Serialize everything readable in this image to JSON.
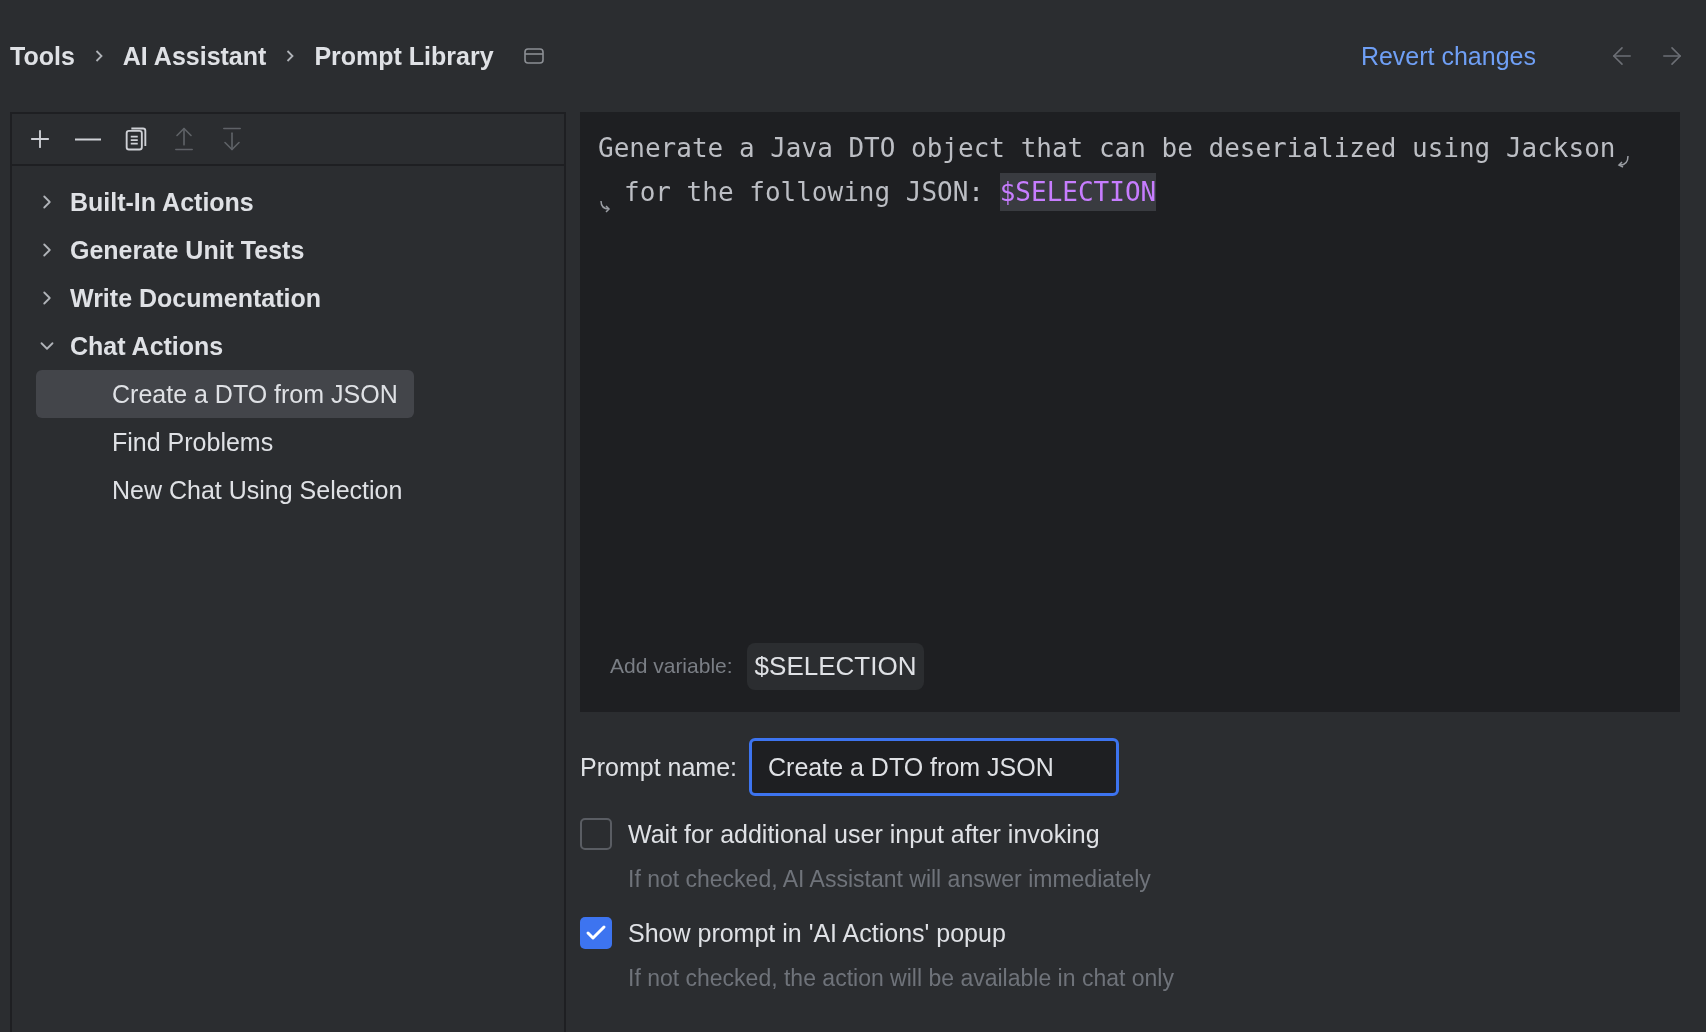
{
  "breadcrumb": [
    "Tools",
    "AI Assistant",
    "Prompt Library"
  ],
  "header": {
    "revert_link": "Revert changes",
    "back_disabled": true,
    "forward_disabled": true
  },
  "toolbar": [
    {
      "kind": "add",
      "disabled": false
    },
    {
      "kind": "remove",
      "disabled": false
    },
    {
      "kind": "copy",
      "disabled": false
    },
    {
      "kind": "move_up",
      "disabled": true
    },
    {
      "kind": "move_down",
      "disabled": true
    }
  ],
  "tree": [
    {
      "label": "Built-In Actions",
      "expanded": false
    },
    {
      "label": "Generate Unit Tests",
      "expanded": false
    },
    {
      "label": "Write Documentation",
      "expanded": false
    },
    {
      "label": "Chat Actions",
      "expanded": true,
      "children": [
        {
          "label": "Create a DTO from JSON",
          "selected": true
        },
        {
          "label": "Find Problems",
          "selected": false
        },
        {
          "label": "New Chat Using Selection",
          "selected": false
        }
      ]
    }
  ],
  "editor": {
    "lines": [
      {
        "continued": false,
        "wrapped": true,
        "segments": [
          {
            "kind": "text",
            "text": "Generate a Java DTO object that can be deserialized using Jackson"
          }
        ]
      },
      {
        "continued": true,
        "wrapped": false,
        "segments": [
          {
            "kind": "text",
            "text": "for the following JSON: "
          },
          {
            "kind": "variable",
            "text": "$SELECTION"
          }
        ]
      }
    ],
    "add_variable_label": "Add variable:",
    "variables": [
      "$SELECTION"
    ]
  },
  "prompt_name": {
    "label": "Prompt name:",
    "value": "Create a DTO from JSON",
    "focused": true
  },
  "options": [
    {
      "label": "Wait for additional user input after invoking",
      "hint": "If not checked, AI Assistant will answer immediately",
      "checked": false
    },
    {
      "label": "Show prompt in 'AI Actions' popup",
      "hint": "If not checked, the action will be available in chat only",
      "checked": true
    }
  ]
}
